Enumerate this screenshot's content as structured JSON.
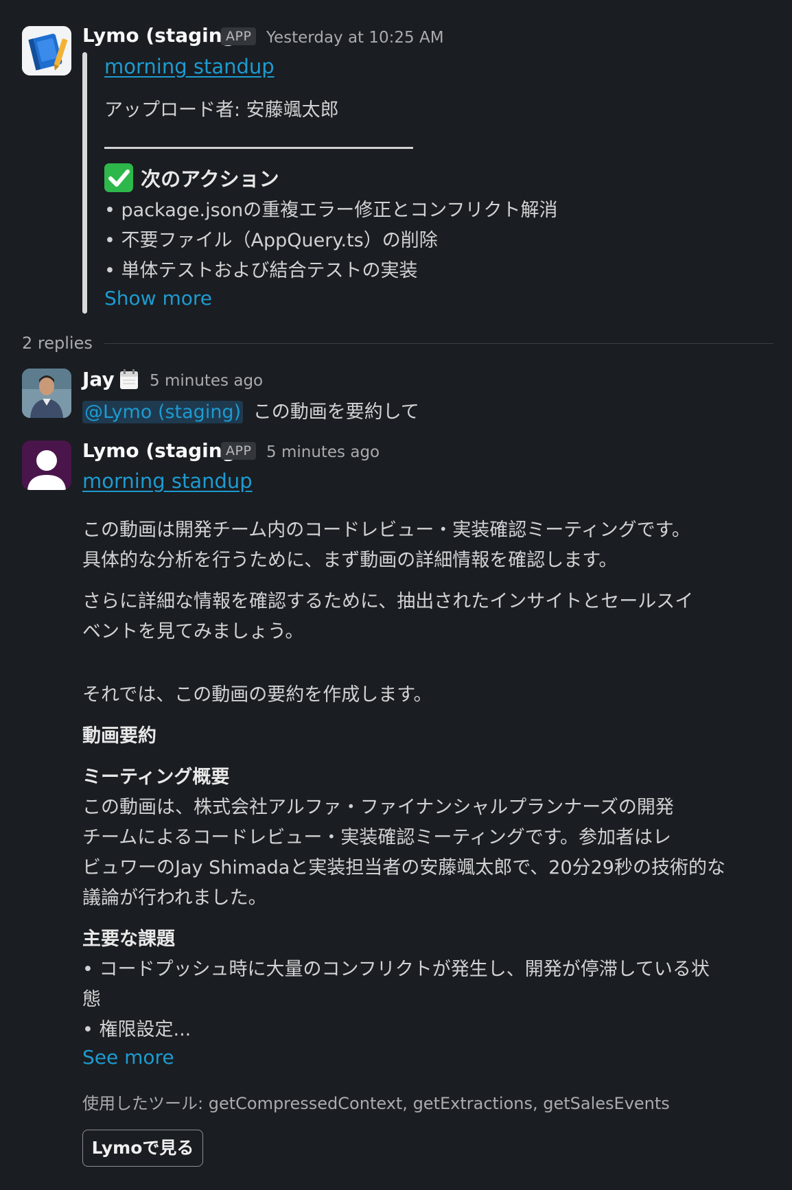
{
  "msg1": {
    "author": "Lymo (staging)",
    "badge": "APP",
    "timestamp": "Yesterday at 10:25 AM",
    "video_link": "morning standup",
    "uploader": "アップロード者: 安藤颯太郎",
    "actions_emoji": "✅",
    "actions_title": "次のアクション",
    "bullets": [
      "package.jsonの重複エラー修正とコンフリクト解消",
      "不要ファイル（AppQuery.ts）の削除",
      "単体テストおよび結合テストの実装"
    ],
    "show_more": "Show more"
  },
  "thread": {
    "replies_count": "2 replies"
  },
  "reply1": {
    "author": "Jay",
    "status_emoji": "🗓",
    "timestamp": "5 minutes ago",
    "mention": "@Lymo (staging)",
    "text": "この動画を要約して"
  },
  "reply2": {
    "author": "Lymo (staging)",
    "badge": "APP",
    "timestamp": "5 minutes ago",
    "video_link": "morning standup",
    "para1_line1": "この動画は開発チーム内のコードレビュー・実装確認ミーティングです。",
    "para1_line2": "具体的な分析を行うために、まず動画の詳細情報を確認します。",
    "para2_line1": "さらに詳細な情報を確認するために、抽出されたインサイトとセールスイ",
    "para2_line2": "ベントを見てみましょう。",
    "para3": "それでは、この動画の要約を作成します。",
    "h_summary": "動画要約",
    "h_overview": "ミーティング概要",
    "overview_lines": [
      "この動画は、株式会社アルファ・ファイナンシャルプランナーズの開発",
      "チームによるコードレビュー・実装確認ミーティングです。参加者はレ",
      "ビュワーのJay Shimadaと実装担当者の安藤颯太郎で、20分29秒の技術的な",
      "議論が行われました。"
    ],
    "h_issues": "主要な課題",
    "issue1_line1": "コードプッシュ時に大量のコンフリクトが発生し、開発が停滞している状",
    "issue1_line2": "態",
    "issue2": "権限設定...",
    "see_more": "See more",
    "tools": "使用したツール: getCompressedContext, getExtractions, getSalesEvents",
    "open_button": "Lymoで見る"
  },
  "colors": {
    "background": "#1a1d21",
    "link": "#1d9bd1",
    "text": "#d1d2d3",
    "quote_bar": "#d9d9d9",
    "avatar_purple": "#4a154b"
  }
}
